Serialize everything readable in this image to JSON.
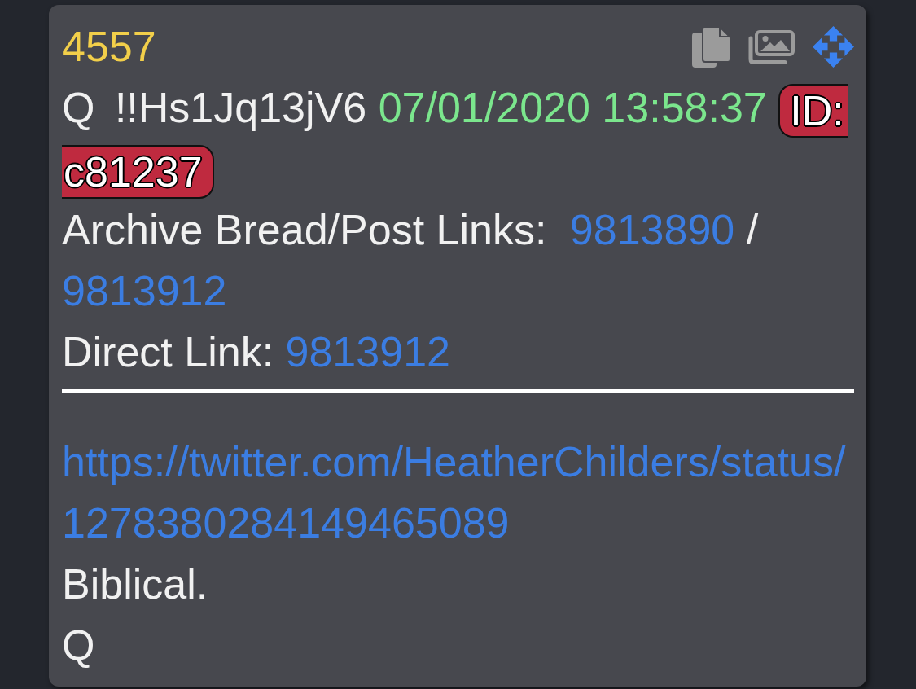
{
  "post": {
    "number": "4557",
    "author": "Q",
    "tripcode": "!!Hs1Jq13jV6",
    "timestamp": "07/01/2020 13:58:37",
    "poster_id": {
      "label": "ID:",
      "value": "c81237"
    },
    "archive_links": {
      "label": "Archive Bread/Post Links:",
      "links": [
        "9813890",
        "9813912"
      ],
      "separator": "/"
    },
    "direct_link": {
      "label": "Direct Link:",
      "link": "9813912"
    },
    "body": [
      {
        "kind": "link",
        "text": "https://twitter.com/HeatherChilders/status/1278380284149465089"
      },
      {
        "kind": "text",
        "text": "Biblical."
      },
      {
        "kind": "text",
        "text": "Q"
      }
    ]
  }
}
